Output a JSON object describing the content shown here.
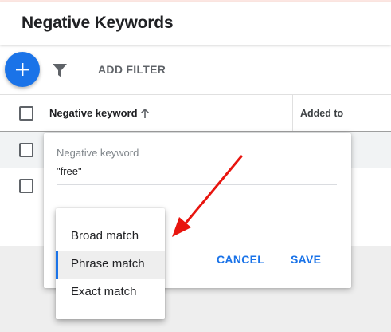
{
  "page": {
    "title": "Negative Keywords"
  },
  "toolbar": {
    "add_filter_label": "ADD FILTER",
    "fab_icon": "plus-icon",
    "filter_icon": "filter-funnel-icon"
  },
  "table": {
    "columns": [
      {
        "label": "Negative keyword",
        "sort": "ascending"
      },
      {
        "label": "Added to"
      }
    ],
    "rows": 3
  },
  "edit_popup": {
    "field_label": "Negative keyword",
    "field_value": "\"free\"",
    "cancel_label": "CANCEL",
    "save_label": "SAVE"
  },
  "match_menu": {
    "items": [
      {
        "label": "Broad match",
        "selected": false
      },
      {
        "label": "Phrase match",
        "selected": true
      },
      {
        "label": "Exact match",
        "selected": false
      }
    ]
  },
  "annotation": {
    "arrow_color": "#e8150f"
  },
  "colors": {
    "accent": "#1a73e8",
    "header_strip": "#fde7e2"
  }
}
